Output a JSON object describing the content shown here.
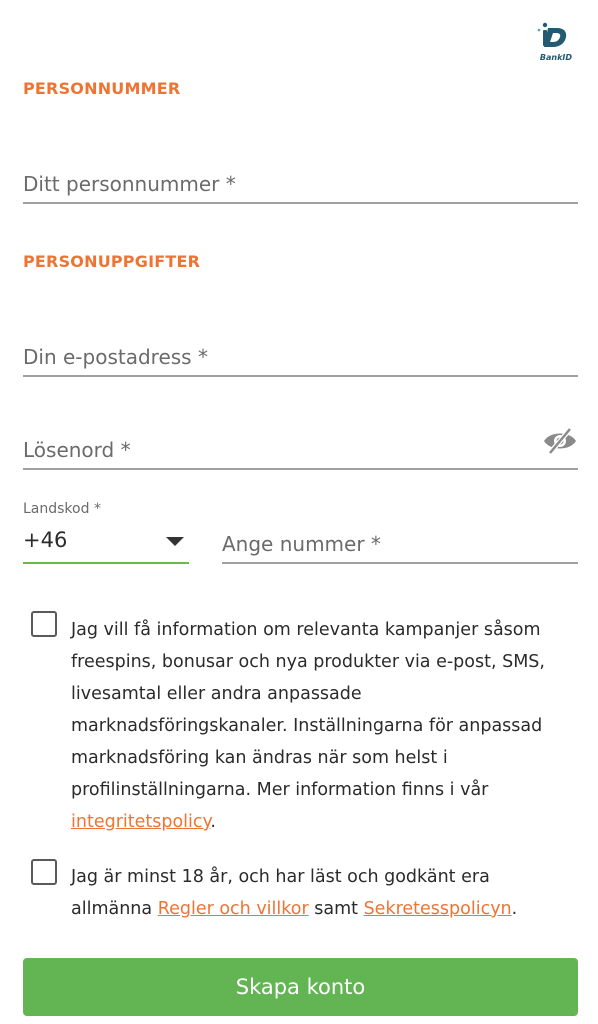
{
  "logo": {
    "icon": "bankid-logo",
    "text": "BankID",
    "color": "#235971"
  },
  "sections": {
    "personnummer_title": "PERSONNUMMER",
    "personuppgifter_title": "PERSONUPPGIFTER"
  },
  "fields": {
    "personnummer_placeholder": "Ditt personnummer *",
    "email_placeholder": "Din e-postadress *",
    "password_placeholder": "Lösenord *",
    "password_toggle_icon": "eye-slash-icon",
    "country_label": "Landskod *",
    "country_value": "+46",
    "phone_placeholder": "Ange nummer *"
  },
  "consent": {
    "marketing_text": "Jag vill få information om relevanta kampanjer såsom freespins, bonusar och nya produkter via e-post, SMS, livesamtal eller andra anpassade marknadsföringskanaler. Inställningarna för anpassad marknadsföring kan ändras när som helst i profilinställningarna. Mer information finns i vår ",
    "marketing_link": "integritetspolicy",
    "marketing_end": ".",
    "age_text": "Jag är minst 18 år, och har läst och godkänt era allmänna ",
    "age_link_terms": "Regler och villkor",
    "age_middle": " samt ",
    "age_link_privacy": "Sekretesspolicyn",
    "age_end": "."
  },
  "button": {
    "label": "Skapa konto"
  },
  "colors": {
    "accent": "#ee7433",
    "primary": "#63b553",
    "underline_active": "#6cb84f"
  }
}
